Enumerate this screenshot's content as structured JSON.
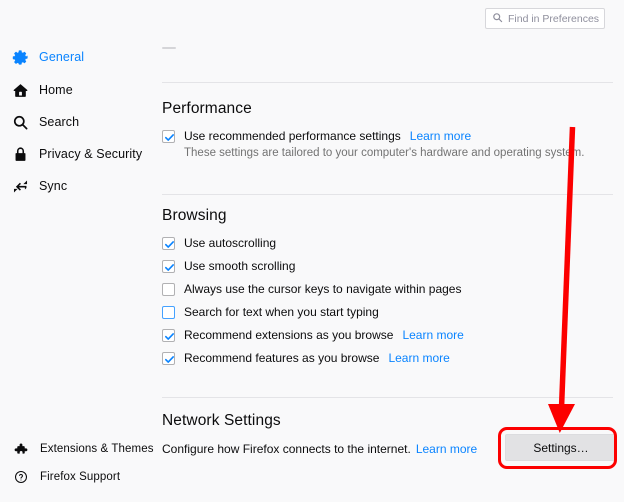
{
  "search": {
    "placeholder": "Find in Preferences",
    "icon": "search-icon"
  },
  "sidebar": {
    "items": [
      {
        "label": "General",
        "icon": "gear-icon",
        "selected": true
      },
      {
        "label": "Home",
        "icon": "home-icon",
        "selected": false
      },
      {
        "label": "Search",
        "icon": "search-icon",
        "selected": false
      },
      {
        "label": "Privacy & Security",
        "icon": "lock-icon",
        "selected": false
      },
      {
        "label": "Sync",
        "icon": "sync-icon",
        "selected": false
      }
    ],
    "bottom_items": [
      {
        "label": "Extensions & Themes",
        "icon": "puzzle-icon"
      },
      {
        "label": "Firefox Support",
        "icon": "question-circle-icon"
      }
    ]
  },
  "sections": {
    "performance": {
      "title": "Performance",
      "checkbox": {
        "label": "Use recommended performance settings",
        "checked": true,
        "focused": false
      },
      "learn_more": "Learn more",
      "description": "These settings are tailored to your computer's hardware and operating system."
    },
    "browsing": {
      "title": "Browsing",
      "options": [
        {
          "label": "Use autoscrolling",
          "checked": true,
          "focused": false,
          "learn_more": ""
        },
        {
          "label": "Use smooth scrolling",
          "checked": true,
          "focused": false,
          "learn_more": ""
        },
        {
          "label": "Always use the cursor keys to navigate within pages",
          "checked": false,
          "focused": false,
          "learn_more": ""
        },
        {
          "label": "Search for text when you start typing",
          "checked": false,
          "focused": true,
          "learn_more": ""
        },
        {
          "label": "Recommend extensions as you browse",
          "checked": true,
          "focused": false,
          "learn_more": "Learn more"
        },
        {
          "label": "Recommend features as you browse",
          "checked": true,
          "focused": false,
          "learn_more": "Learn more"
        }
      ]
    },
    "network": {
      "title": "Network Settings",
      "description": "Configure how Firefox connects to the internet.",
      "learn_more": "Learn more",
      "settings_button": "Settings…"
    }
  },
  "annotation": {
    "arrow_color": "#fc0000",
    "highlight_color": "#fc0000",
    "target": "settings-button"
  },
  "colors": {
    "accent": "#0a84ff",
    "background": "#f9f9fa",
    "text": "#0c0c0d",
    "muted_text": "#737373",
    "separator": "#e4e4e7",
    "button_face": "#e2e2e4"
  }
}
